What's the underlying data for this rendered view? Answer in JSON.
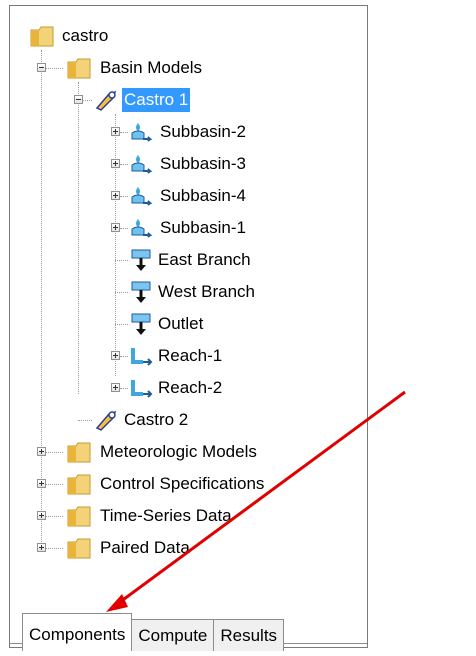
{
  "tree": {
    "root": "castro",
    "basin_models": "Basin Models",
    "castro1": "Castro 1",
    "subbasins": [
      "Subbasin-2",
      "Subbasin-3",
      "Subbasin-4",
      "Subbasin-1"
    ],
    "junctions": [
      "East Branch",
      "West Branch",
      "Outlet"
    ],
    "reaches": [
      "Reach-1",
      "Reach-2"
    ],
    "castro2": "Castro 2",
    "meteorologic": "Meteorologic Models",
    "control": "Control Specifications",
    "timeseries": "Time-Series Data",
    "paired": "Paired Data"
  },
  "tabs": [
    "Components",
    "Compute",
    "Results"
  ],
  "colors": {
    "selection": "#3399ff",
    "annotation_arrow": "#e00000",
    "folder": "#e8b43a"
  }
}
